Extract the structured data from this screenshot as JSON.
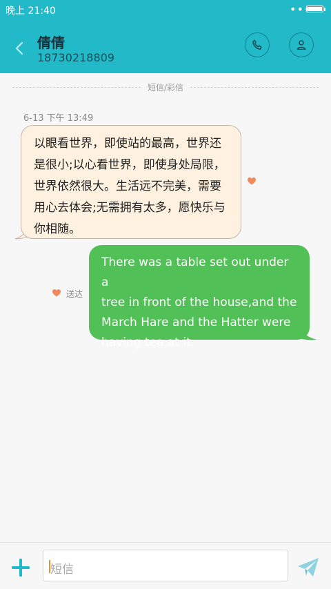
{
  "status_bar": {
    "time": "晚上 21:40",
    "dots": "•••"
  },
  "header": {
    "name": "倩倩",
    "phone": "18730218809"
  },
  "divider_label": "短信/彩信",
  "messages": [
    {
      "direction": "incoming",
      "timestamp": "6-13 下午 13:49",
      "lines": [
        "以眼看世界，即使站的最高，世界还",
        "是很小;以心看世界，即使身处局限，",
        "世界依然很大。生活远不完美，需要",
        "用心去体会;无需拥有太多，愿快乐与",
        "你相随。"
      ]
    },
    {
      "direction": "outgoing",
      "status": "送达",
      "lines": [
        "There was a table set out under a",
        "tree in front of the house,and the",
        "March Hare and the Hatter were",
        "having tea at it."
      ]
    }
  ],
  "composer": {
    "placeholder": "短信"
  },
  "colors": {
    "header": "#22b9c8",
    "incoming_bubble": "#fef1e0",
    "outgoing_bubble": "#51c057",
    "accent_orange": "#f08a35"
  },
  "icons": {
    "back": "chevron-left-icon",
    "call": "phone-icon",
    "contact": "person-icon",
    "add": "plus-icon",
    "send": "paper-plane-icon",
    "heart": "heart-icon"
  }
}
